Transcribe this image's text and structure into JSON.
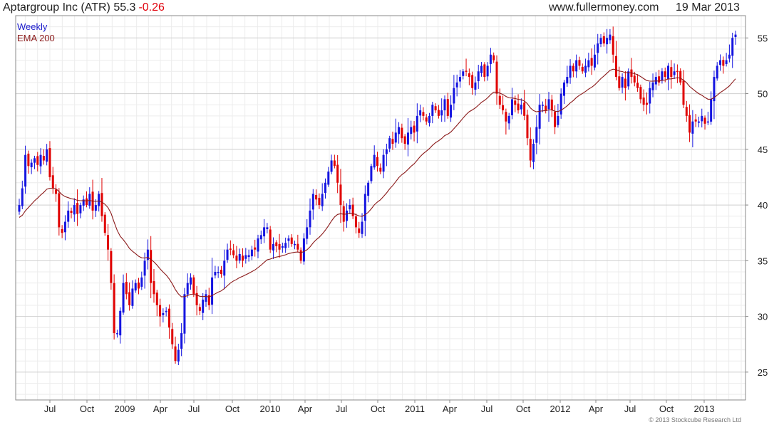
{
  "header": {
    "title": "Aptargroup Inc (ATR) 55.3",
    "change": "-0.26",
    "change_color": "#e0000b",
    "site": "www.fullermoney.com",
    "date": "19 Mar 2013"
  },
  "footer": {
    "copyright": "© 2013 Stockcube Research Ltd"
  },
  "chart_data": {
    "type": "candlestick",
    "frequency_label": "Weekly",
    "legend": [
      {
        "label": "Weekly",
        "color": "#1a1acc"
      },
      {
        "label": "EMA 200",
        "color": "#8b1a1a"
      }
    ],
    "colors": {
      "up": "#1515e0",
      "down": "#e00000",
      "ema": "#8b1a1a",
      "grid": "#cfcfcf",
      "grid_minor": "#ececec"
    },
    "ylim": [
      22.5,
      57
    ],
    "y_ticks": [
      25,
      30,
      35,
      40,
      45,
      50,
      55
    ],
    "right_axis": true,
    "grid": true,
    "x_ticks": [
      "Jul",
      "Oct",
      "2009",
      "Apr",
      "Jul",
      "Oct",
      "2010",
      "Apr",
      "Jul",
      "Oct",
      "2011",
      "Apr",
      "Jul",
      "Oct",
      "2012",
      "Apr",
      "Jul",
      "Oct",
      "2013"
    ],
    "closes": [
      40,
      41.5,
      44.5,
      43.5,
      43.8,
      44.2,
      43.6,
      44.5,
      44,
      45,
      42.5,
      41.5,
      41,
      38,
      37.5,
      38.5,
      39.5,
      39.3,
      40,
      39.2,
      40,
      40.5,
      40,
      41,
      39.5,
      40,
      41,
      39,
      37.5,
      36,
      33,
      28.5,
      28.5,
      30.5,
      33,
      32,
      31,
      32.5,
      33,
      32.5,
      33.5,
      35,
      36,
      33,
      32,
      31,
      30,
      30.3,
      30.5,
      29,
      27.5,
      26,
      27,
      28.5,
      32,
      33,
      33.5,
      32,
      31,
      30.5,
      31.5,
      32,
      31,
      33.5,
      34,
      34,
      33.8,
      35,
      36,
      36,
      35.5,
      35,
      35.6,
      35,
      35.5,
      35.5,
      36,
      36,
      37,
      37.3,
      38,
      38,
      36,
      36.5,
      36.3,
      36,
      36.3,
      36.6,
      37,
      36.5,
      36.5,
      36,
      35,
      37,
      38,
      39.5,
      41,
      40.5,
      40,
      41,
      42,
      43,
      44,
      43.5,
      42,
      40,
      38.5,
      39.5,
      40,
      39,
      38,
      37.5,
      38.5,
      41,
      42,
      43.5,
      44.5,
      43.5,
      43,
      44.5,
      45,
      46,
      45.5,
      46.5,
      47,
      46,
      45.5,
      46.5,
      47,
      46.5,
      48,
      48.5,
      48,
      47.5,
      48,
      49,
      48.5,
      48,
      48.5,
      49.5,
      48,
      49,
      50.5,
      51,
      51.5,
      52,
      52,
      51.5,
      50.5,
      51,
      52,
      52.5,
      51.5,
      52.5,
      53.5,
      53,
      50,
      49,
      48.5,
      47.5,
      48,
      49.5,
      49,
      48.5,
      49,
      48,
      46,
      44,
      45.5,
      47,
      49,
      49,
      48.5,
      49.5,
      48.5,
      47,
      48,
      50,
      51,
      51.5,
      52.5,
      52,
      53,
      52.5,
      52,
      52.5,
      53,
      52.5,
      53.5,
      54.5,
      55,
      54.5,
      55,
      55.3,
      53.5,
      51.5,
      50.5,
      51.5,
      50.5,
      52,
      51.5,
      51,
      50.5,
      49.5,
      49,
      49,
      50.5,
      51,
      51.5,
      51,
      52,
      51.5,
      52.5,
      51.5,
      52,
      52,
      51,
      49,
      48,
      46.5,
      47.5,
      47.5,
      47.5,
      48,
      47.3,
      47.5,
      49.5,
      51.5,
      52.5,
      53,
      52.5,
      53,
      53.5,
      55,
      55.3
    ]
  }
}
